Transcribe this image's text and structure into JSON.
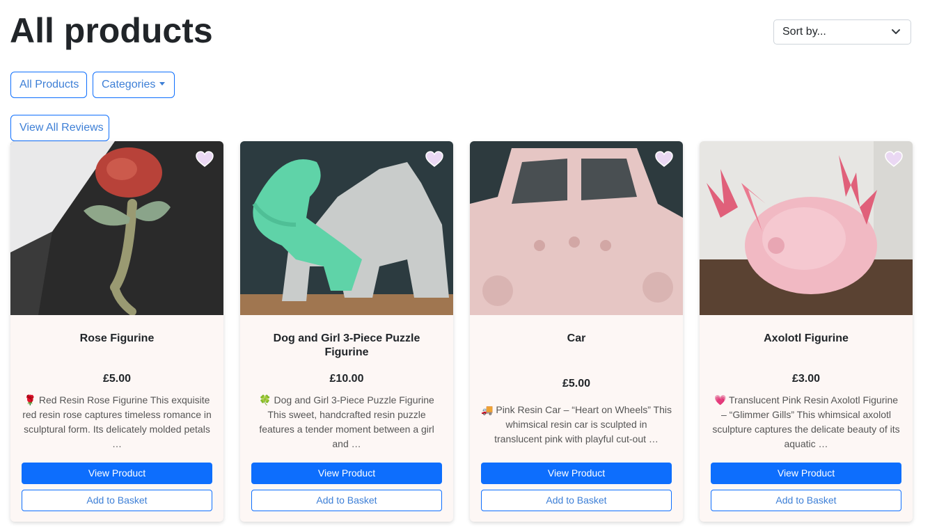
{
  "page": {
    "title": "All products"
  },
  "sort": {
    "label": "Sort by..."
  },
  "filters": {
    "all_products": "All Products",
    "categories": "Categories",
    "view_reviews": "View All Reviews"
  },
  "products": [
    {
      "name": "Rose Figurine",
      "price": "£5.00",
      "description": "🌹 Red Resin Rose Figurine This exquisite red resin rose captures timeless romance in sculptural form. Its delicately molded petals …",
      "view_label": "View Product",
      "basket_label": "Add to Basket",
      "favourite_icon": "heart-icon"
    },
    {
      "name": "Dog and Girl 3-Piece Puzzle Figurine",
      "price": "£10.00",
      "description": "🍀 Dog and Girl 3-Piece Puzzle Figurine This sweet, handcrafted resin puzzle features a tender moment between a girl and …",
      "view_label": "View Product",
      "basket_label": "Add to Basket",
      "favourite_icon": "heart-icon"
    },
    {
      "name": "Car",
      "price": "£5.00",
      "description": "🚚 Pink Resin Car – “Heart on Wheels” This whimsical resin car is sculpted in translucent pink with playful cut-out …",
      "view_label": "View Product",
      "basket_label": "Add to Basket",
      "favourite_icon": "heart-icon"
    },
    {
      "name": "Axolotl Figurine",
      "price": "£3.00",
      "description": "💗 Translucent Pink Resin Axolotl Figurine – “Glimmer Gills” This whimsical axolotl sculpture captures the delicate beauty of its aquatic …",
      "view_label": "View Product",
      "basket_label": "Add to Basket",
      "favourite_icon": "heart-icon"
    }
  ],
  "colors": {
    "primary": "#0d6efd",
    "card_background": "#fdf7f5",
    "heart": "#e9d8f2"
  }
}
